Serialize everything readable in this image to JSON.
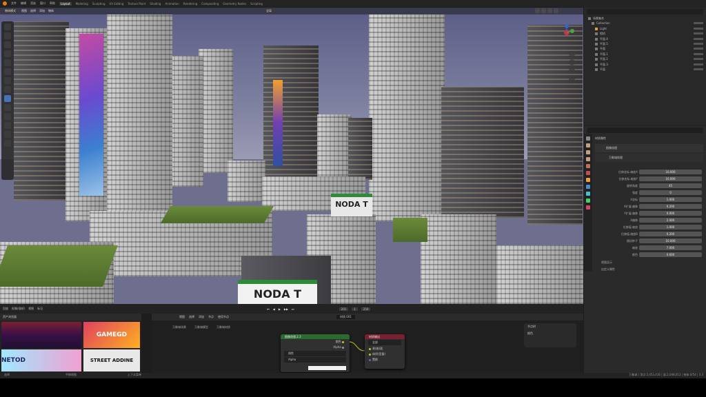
{
  "topbar": {
    "menus": [
      "文件",
      "编辑",
      "渲染",
      "窗口",
      "帮助"
    ],
    "workspaces": [
      "Layout",
      "Modeling",
      "Sculpting",
      "UV Editing",
      "Texture Paint",
      "Shading",
      "Animation",
      "Rendering",
      "Compositing",
      "Geometry Nodes",
      "Scripting"
    ],
    "active_workspace": "Layout",
    "scene": "Scene",
    "view_layer": "ViewLayer"
  },
  "viewport": {
    "mode": "物体模式",
    "menus": [
      "视图",
      "选择",
      "添加",
      "物体"
    ],
    "transform": "全局",
    "billboard_labels": [
      "NODA T",
      "NODA T"
    ]
  },
  "timeline": {
    "menus": [
      "回放",
      "抠像(插帧)",
      "视图",
      "标记"
    ],
    "current_frame": "201",
    "start": "1",
    "end": "250"
  },
  "node_editor": {
    "menus": [
      "视图",
      "选择",
      "添加",
      "节点"
    ],
    "use_nodes_label": "使用节点",
    "object_label": "物体",
    "material": "材质.001",
    "breadcrumbs": [
      "万象城场景",
      "万象城模型",
      "万象城材质"
    ],
    "node1": {
      "title": "图像纹理.2.2",
      "rows": [
        "颜色",
        "Alpha",
        "线性",
        "Alpha"
      ]
    },
    "node2": {
      "title": "材质输出",
      "rows": [
        "全部",
        "表(曲)面",
        "体积(音量)",
        "置换"
      ]
    }
  },
  "assets": {
    "label": "资产浏览器",
    "thumbs": [
      "GAMEGD",
      "STREET ADDINE",
      "NETOD"
    ]
  },
  "right_node_panel": {
    "title": "节点树",
    "label": "颜色"
  },
  "outliner": {
    "search_placeholder": "",
    "items": [
      "场景集合",
      "Collection",
      "Light",
      "相机",
      "平面.4",
      "平面.5",
      "平面",
      "平面.1",
      "平面.2",
      "平面.3",
      "平面"
    ]
  },
  "properties": {
    "header": "材质属性",
    "section": "图像纹理",
    "subsection": "万象城纹理",
    "rows": [
      {
        "label": "位移坐标.缩放X",
        "value": "10.000"
      },
      {
        "label": "位移坐标.缩放Y",
        "value": "10.000"
      },
      {
        "label": "旋转角度",
        "value": "45"
      },
      {
        "label": "强度",
        "value": "0"
      },
      {
        "label": "X坐标",
        "value": "1.000"
      },
      {
        "label": "X扩展.偏移",
        "value": "0.200"
      },
      {
        "label": "Y扩展.偏移",
        "value": "0.000"
      },
      {
        "label": "X偏移",
        "value": "2.000"
      },
      {
        "label": "位移值.缩放",
        "value": "1.000"
      },
      {
        "label": "位移值.缩放B",
        "value": "0.200"
      },
      {
        "label": "随机种子",
        "value": "10.000"
      },
      {
        "label": "缩放",
        "value": "7.000"
      },
      {
        "label": "颜色",
        "value": "0.600"
      }
    ],
    "footer": [
      "视图显示",
      "自定义属性"
    ]
  },
  "status_bar": {
    "left": "选择",
    "middle": "平移视图",
    "right": "上下文菜单",
    "stats": "万象城 | 顶点:2,453,416 | 面:2,048,012 | 物体:0/54 | 3.3"
  }
}
